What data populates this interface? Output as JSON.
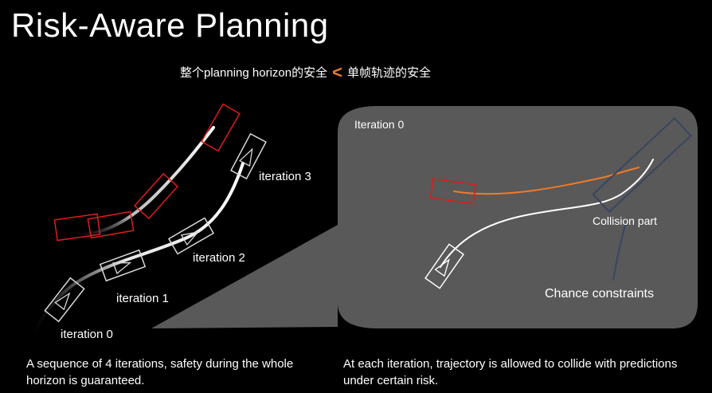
{
  "title": "Risk-Aware Planning",
  "subtitle": {
    "left": "整个planning horizon的安全",
    "symbol": "<",
    "right": "单帧轨迹的安全"
  },
  "iteration_labels": [
    "iteration 0",
    "iteration 1",
    "iteration 2",
    "iteration 3"
  ],
  "panel": {
    "heading": "Iteration 0",
    "collision_label": "Collision part",
    "chance_label": "Chance constraints"
  },
  "captions": {
    "left": "A sequence of 4 iterations, safety during the whole horizon is guaranteed.",
    "right": "At each iteration, trajectory is allowed to collide with predictions under certain risk."
  },
  "colors": {
    "background": "#000000",
    "panel": "#595959",
    "prediction_box": "#e01b1b",
    "prediction_path": "#f07a2a",
    "collision_box": "#3a4560",
    "accent": "#f07a2a"
  }
}
